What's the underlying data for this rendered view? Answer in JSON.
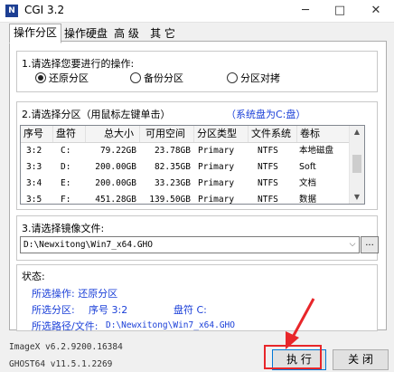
{
  "window": {
    "title": "CGI 3.2",
    "icon": "app-logo-icon",
    "minimize": "─",
    "maximize": "□",
    "close": "✕"
  },
  "tabs": [
    {
      "label": "操作分区",
      "active": true
    },
    {
      "label": "操作硬盘",
      "active": false
    },
    {
      "label": "高 级",
      "active": false
    },
    {
      "label": "其 它",
      "active": false
    }
  ],
  "step1": {
    "title": "1.请选择您要进行的操作:",
    "options": [
      {
        "label": "还原分区",
        "selected": true
      },
      {
        "label": "备份分区",
        "selected": false
      },
      {
        "label": "分区对拷",
        "selected": false
      }
    ]
  },
  "step2": {
    "title": "2.请选择分区（用鼠标左键单击）",
    "hint": "（系统盘为C:盘）",
    "columns": [
      "序号",
      "盘符",
      "总大小",
      "可用空间",
      "分区类型",
      "文件系统",
      "卷标"
    ],
    "rows": [
      [
        "3:2",
        "C:",
        "79.22GB",
        "23.78GB",
        "Primary",
        "NTFS",
        "本地磁盘"
      ],
      [
        "3:3",
        "D:",
        "200.00GB",
        "82.35GB",
        "Primary",
        "NTFS",
        "Soft"
      ],
      [
        "3:4",
        "E:",
        "200.00GB",
        "33.23GB",
        "Primary",
        "NTFS",
        "文档"
      ],
      [
        "3:5",
        "F:",
        "451.28GB",
        "139.50GB",
        "Primary",
        "NTFS",
        "数据"
      ]
    ]
  },
  "step3": {
    "title": "3.请选择镜像文件:",
    "path": "D:\\Newxitong\\Win7_x64.GHO",
    "browse": "..."
  },
  "status": {
    "title": "状态:",
    "operation": "所选操作: 还原分区",
    "partition_label": "所选分区:",
    "partition_num": "序号 3:2",
    "partition_drive": "盘符 C:",
    "path_label": "所选路径/文件:",
    "path_value": "D:\\Newxitong\\Win7_x64.GHO"
  },
  "versions": {
    "imagex": "ImageX v6.2.9200.16384",
    "ghost": "GHOST64 v11.5.1.2269"
  },
  "buttons": {
    "run": "执 行",
    "close": "关 闭"
  },
  "colors": {
    "highlight": "#e8262a",
    "hint": "#1a3fd8"
  }
}
